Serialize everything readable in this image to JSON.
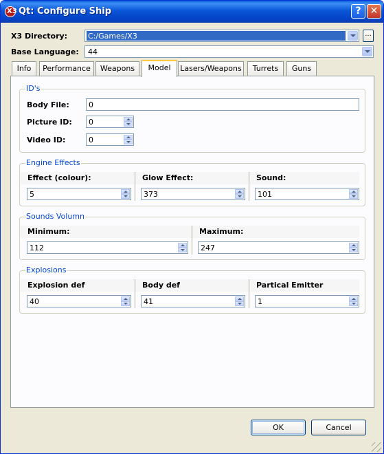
{
  "window": {
    "title": "Qt: Configure Ship",
    "app_icon_glyph": "X3",
    "help_label": "?",
    "close_label": "✕"
  },
  "top": {
    "x3_dir_label": "X3 Directory:",
    "x3_dir_value": "C:/Games/X3",
    "browse_label": "...",
    "base_lang_label": "Base Language:",
    "base_lang_value": "44"
  },
  "tabs": [
    {
      "label": "Info"
    },
    {
      "label": "Performance"
    },
    {
      "label": "Weapons"
    },
    {
      "label": "Model"
    },
    {
      "label": "Lasers/Weapons"
    },
    {
      "label": "Turrets"
    },
    {
      "label": "Guns"
    }
  ],
  "active_tab": "Model",
  "ids": {
    "title": "ID's",
    "body_file_label": "Body File:",
    "body_file_value": "0",
    "picture_id_label": "Picture ID:",
    "picture_id_value": "0",
    "video_id_label": "Video ID:",
    "video_id_value": "0"
  },
  "engine": {
    "title": "Engine Effects",
    "effect_label": "Effect (colour):",
    "effect_value": "5",
    "glow_label": "Glow Effect:",
    "glow_value": "373",
    "sound_label": "Sound:",
    "sound_value": "101"
  },
  "sounds": {
    "title": "Sounds Volumn",
    "min_label": "Minimum:",
    "min_value": "112",
    "max_label": "Maximum:",
    "max_value": "247"
  },
  "explosions": {
    "title": "Explosions",
    "explosion_def_label": "Explosion def",
    "explosion_def_value": "40",
    "body_def_label": "Body def",
    "body_def_value": "41",
    "emitter_label": "Partical Emitter",
    "emitter_value": "1"
  },
  "buttons": {
    "ok": "OK",
    "cancel": "Cancel"
  },
  "colors": {
    "title_bar": "#0a5fdb",
    "group_title": "#0046d5",
    "selection": "#316ac5",
    "active_tab_accent": "#ffc83c"
  }
}
